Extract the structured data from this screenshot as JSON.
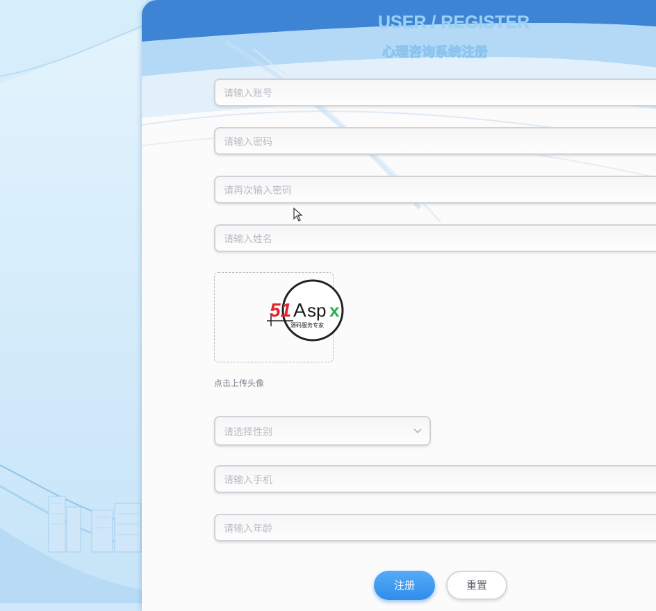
{
  "header": {
    "title_en": "USER / REGISTER",
    "title_cn": "心理咨询系统注册"
  },
  "form": {
    "account_placeholder": "请输入账号",
    "password_placeholder": "请输入密码",
    "confirm_password_placeholder": "请再次输入密码",
    "name_placeholder": "请输入姓名",
    "avatar_upload_label": "点击上传头像",
    "gender_placeholder": "请选择性别",
    "phone_placeholder": "请输入手机",
    "age_placeholder": "请输入年龄"
  },
  "watermark": {
    "brand": "51Aspx",
    "tagline": "源码服务专家"
  },
  "buttons": {
    "register": "注册",
    "reset": "重置"
  },
  "colors": {
    "primary": "#3592ec",
    "title": "#9ed0f3",
    "background": "#d2ebfb"
  },
  "icons": {
    "select_arrow": "chevron-down-icon",
    "pointer": "mouse-cursor-icon"
  }
}
